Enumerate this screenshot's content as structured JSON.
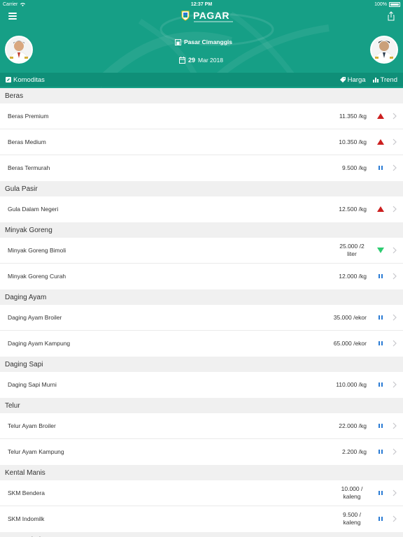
{
  "status_bar": {
    "carrier": "Carrier",
    "time": "12:37 PM",
    "battery": "100%"
  },
  "app": {
    "title": "PAGAR"
  },
  "header": {
    "market": "Pasar Cimanggis",
    "date_day": "29",
    "date_rest": "Mar 2018"
  },
  "tabs": {
    "komoditas": "Komoditas",
    "harga": "Harga",
    "trend": "Trend"
  },
  "colors": {
    "brand": "#169f86",
    "up": "#cc1f1f",
    "down": "#2ecc71",
    "flat": "#2a7bd4"
  },
  "sections": [
    {
      "title": "Beras",
      "items": [
        {
          "name": "Beras Premium",
          "price": "11.350 /kg",
          "trend": "up"
        },
        {
          "name": "Beras Medium",
          "price": "10.350 /kg",
          "trend": "up"
        },
        {
          "name": "Beras Termurah",
          "price": "9.500 /kg",
          "trend": "flat"
        }
      ]
    },
    {
      "title": "Gula Pasir",
      "items": [
        {
          "name": "Gula Dalam Negeri",
          "price": "12.500 /kg",
          "trend": "up"
        }
      ]
    },
    {
      "title": "Minyak Goreng",
      "items": [
        {
          "name": "Minyak Goreng Bimoli",
          "price": "25.000 /2 liter",
          "trend": "down"
        },
        {
          "name": "Minyak Goreng Curah",
          "price": "12.000 /kg",
          "trend": "flat"
        }
      ]
    },
    {
      "title": "Daging Ayam",
      "items": [
        {
          "name": "Daging Ayam Broiler",
          "price": "35.000 /ekor",
          "trend": "flat"
        },
        {
          "name": "Daging Ayam Kampung",
          "price": "65.000 /ekor",
          "trend": "flat"
        }
      ]
    },
    {
      "title": "Daging Sapi",
      "items": [
        {
          "name": "Daging Sapi Murni",
          "price": "110.000 /kg",
          "trend": "flat"
        }
      ]
    },
    {
      "title": "Telur",
      "items": [
        {
          "name": "Telur Ayam Broiler",
          "price": "22.000 /kg",
          "trend": "flat"
        },
        {
          "name": "Telur Ayam Kampung",
          "price": "2.200 /kg",
          "trend": "flat"
        }
      ]
    },
    {
      "title": "Kental Manis",
      "items": [
        {
          "name": "SKM Bendera",
          "price": "10.000 / kaleng",
          "trend": "flat"
        },
        {
          "name": "SKM Indomilk",
          "price": "9.500 / kaleng",
          "trend": "flat"
        }
      ]
    },
    {
      "title": "Susu Bubuk",
      "items": []
    }
  ]
}
